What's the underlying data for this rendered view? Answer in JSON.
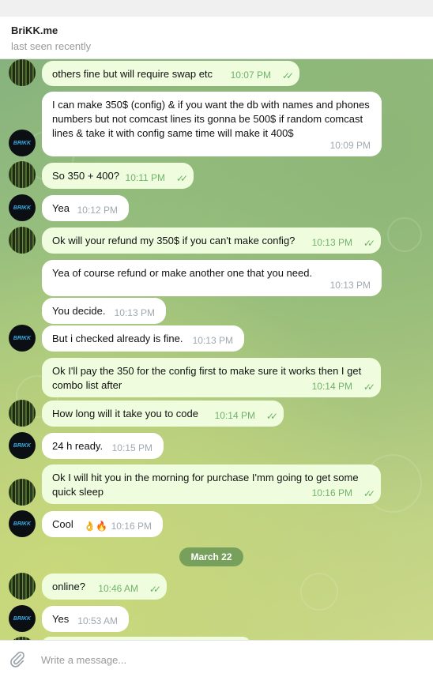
{
  "header": {
    "name": "BriKK.me",
    "status": "last seen recently"
  },
  "avatars": {
    "brikk_label": "BRIKK"
  },
  "messages": [
    {
      "text": "others fine but will require swap etc",
      "time": "10:07 PM",
      "dir": "out"
    },
    {
      "text": "I can make 350$ (config) & if you want the db with names and phones numbers but not comcast lines its gonna be 500$ if random comcast lines & take it with config same time will make it 400$",
      "time": "10:09 PM",
      "dir": "in"
    },
    {
      "text": "So 350 + 400?",
      "time": "10:11 PM",
      "dir": "out"
    },
    {
      "text": "Yea",
      "time": "10:12 PM",
      "dir": "in"
    },
    {
      "text": "Ok will your refund my 350$ if you can't make config?",
      "time": "10:13 PM",
      "dir": "out"
    },
    {
      "text": "Yea of course refund or make another one that you need.",
      "time": "10:13 PM",
      "dir": "in"
    },
    {
      "text": "You decide.",
      "time": "10:13 PM",
      "dir": "in"
    },
    {
      "text": "But i checked already is fine.",
      "time": "10:13 PM",
      "dir": "in"
    },
    {
      "text": "Ok I'll pay the 350 for the config first to make sure it works then I get combo list after",
      "time": "10:14 PM",
      "dir": "out"
    },
    {
      "text": "How long will it take you to code",
      "time": "10:14 PM",
      "dir": "out"
    },
    {
      "text": "24 h ready.",
      "time": "10:15 PM",
      "dir": "in"
    },
    {
      "text": "Ok I will hit you in the morning for purchase I'mm going to get some quick sleep",
      "time": "10:16 PM",
      "dir": "out"
    },
    {
      "text": "Cool",
      "emoji": "👌🔥",
      "time": "10:16 PM",
      "dir": "in"
    },
    {
      "text": "online?",
      "time": "10:46 AM",
      "dir": "out"
    },
    {
      "text": "Yes",
      "time": "10:53 AM",
      "dir": "in"
    }
  ],
  "date_divider": "March 22",
  "composer": {
    "placeholder": "Write a message..."
  },
  "icons": {
    "attach": "paperclip-icon",
    "read": "double-check-icon"
  },
  "colors": {
    "outgoing_bubble": "#effdde",
    "incoming_bubble": "#ffffff",
    "check": "#6fb36a"
  }
}
